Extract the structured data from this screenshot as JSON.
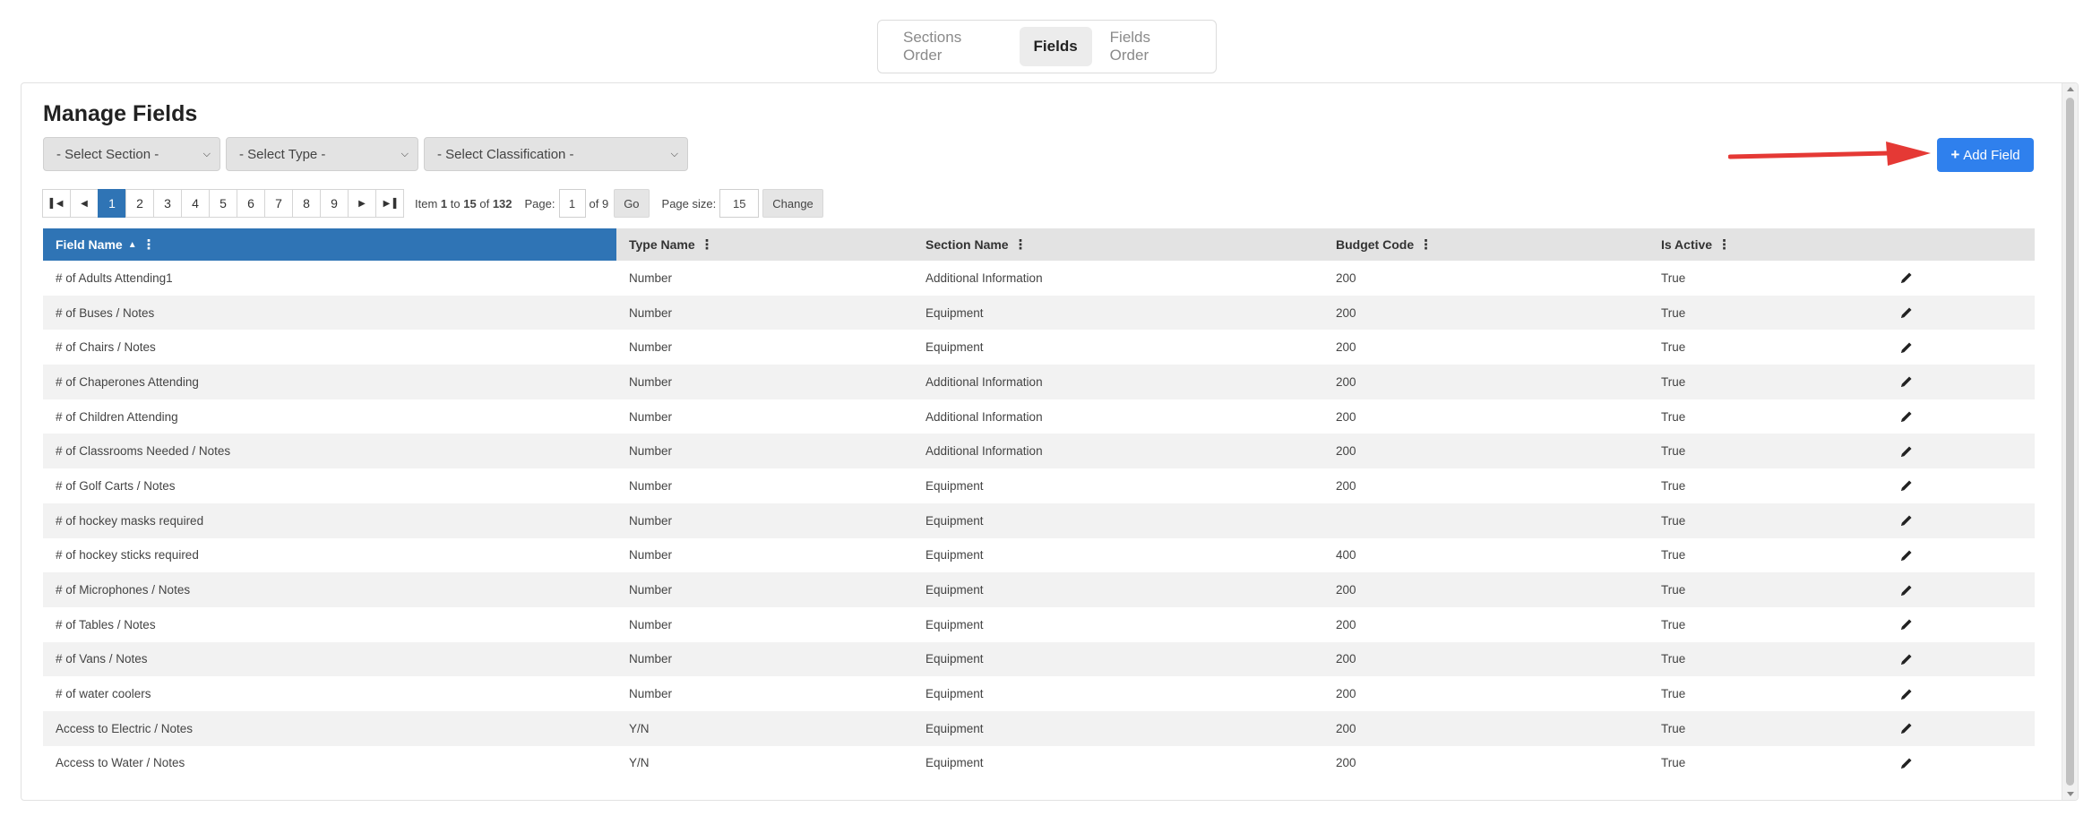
{
  "tabs": [
    {
      "label": "Sections Order",
      "active": false
    },
    {
      "label": "Fields",
      "active": true
    },
    {
      "label": "Fields Order",
      "active": false
    }
  ],
  "page_title": "Manage Fields",
  "filters": {
    "section": "- Select Section -",
    "type": "- Select Type -",
    "classification": "- Select Classification -"
  },
  "add_button": {
    "label": "Add Field",
    "color": "#2f80ed"
  },
  "pager": {
    "pages": [
      "1",
      "2",
      "3",
      "4",
      "5",
      "6",
      "7",
      "8",
      "9"
    ],
    "current_page": "1",
    "item_label": "Item",
    "item_from": "1",
    "to_label": "to",
    "item_to": "15",
    "of_label": "of",
    "item_total": "132",
    "page_label": "Page:",
    "page_input": "1",
    "page_of": "of 9",
    "go_label": "Go",
    "page_size_label": "Page size:",
    "page_size": "15",
    "change_label": "Change"
  },
  "columns": {
    "field_name": "Field Name",
    "type_name": "Type Name",
    "section_name": "Section Name",
    "budget_code": "Budget Code",
    "is_active": "Is Active"
  },
  "rows": [
    {
      "field": "# of Adults Attending1",
      "type": "Number",
      "section": "Additional Information",
      "budget": "200",
      "active": "True"
    },
    {
      "field": "# of Buses / Notes",
      "type": "Number",
      "section": "Equipment",
      "budget": "200",
      "active": "True"
    },
    {
      "field": "# of Chairs / Notes",
      "type": "Number",
      "section": "Equipment",
      "budget": "200",
      "active": "True"
    },
    {
      "field": "# of Chaperones Attending",
      "type": "Number",
      "section": "Additional Information",
      "budget": "200",
      "active": "True"
    },
    {
      "field": "# of Children Attending",
      "type": "Number",
      "section": "Additional Information",
      "budget": "200",
      "active": "True"
    },
    {
      "field": "# of Classrooms Needed / Notes",
      "type": "Number",
      "section": "Additional Information",
      "budget": "200",
      "active": "True"
    },
    {
      "field": "# of Golf Carts / Notes",
      "type": "Number",
      "section": "Equipment",
      "budget": "200",
      "active": "True"
    },
    {
      "field": "# of hockey masks required",
      "type": "Number",
      "section": "Equipment",
      "budget": "",
      "active": "True"
    },
    {
      "field": "# of hockey sticks required",
      "type": "Number",
      "section": "Equipment",
      "budget": "400",
      "active": "True"
    },
    {
      "field": "# of Microphones / Notes",
      "type": "Number",
      "section": "Equipment",
      "budget": "200",
      "active": "True"
    },
    {
      "field": "# of Tables / Notes",
      "type": "Number",
      "section": "Equipment",
      "budget": "200",
      "active": "True"
    },
    {
      "field": "# of Vans / Notes",
      "type": "Number",
      "section": "Equipment",
      "budget": "200",
      "active": "True"
    },
    {
      "field": "# of water coolers",
      "type": "Number",
      "section": "Equipment",
      "budget": "200",
      "active": "True"
    },
    {
      "field": "Access to Electric / Notes",
      "type": "Y/N",
      "section": "Equipment",
      "budget": "200",
      "active": "True"
    },
    {
      "field": "Access to Water / Notes",
      "type": "Y/N",
      "section": "Equipment",
      "budget": "200",
      "active": "True"
    }
  ],
  "icons": {
    "edit": "pencil-icon",
    "first": "first-page-icon",
    "prev": "prev-page-icon",
    "next": "next-page-icon",
    "last": "last-page-icon"
  },
  "colors": {
    "header_sorted": "#2f74b5",
    "annotation_arrow": "#e53935"
  }
}
